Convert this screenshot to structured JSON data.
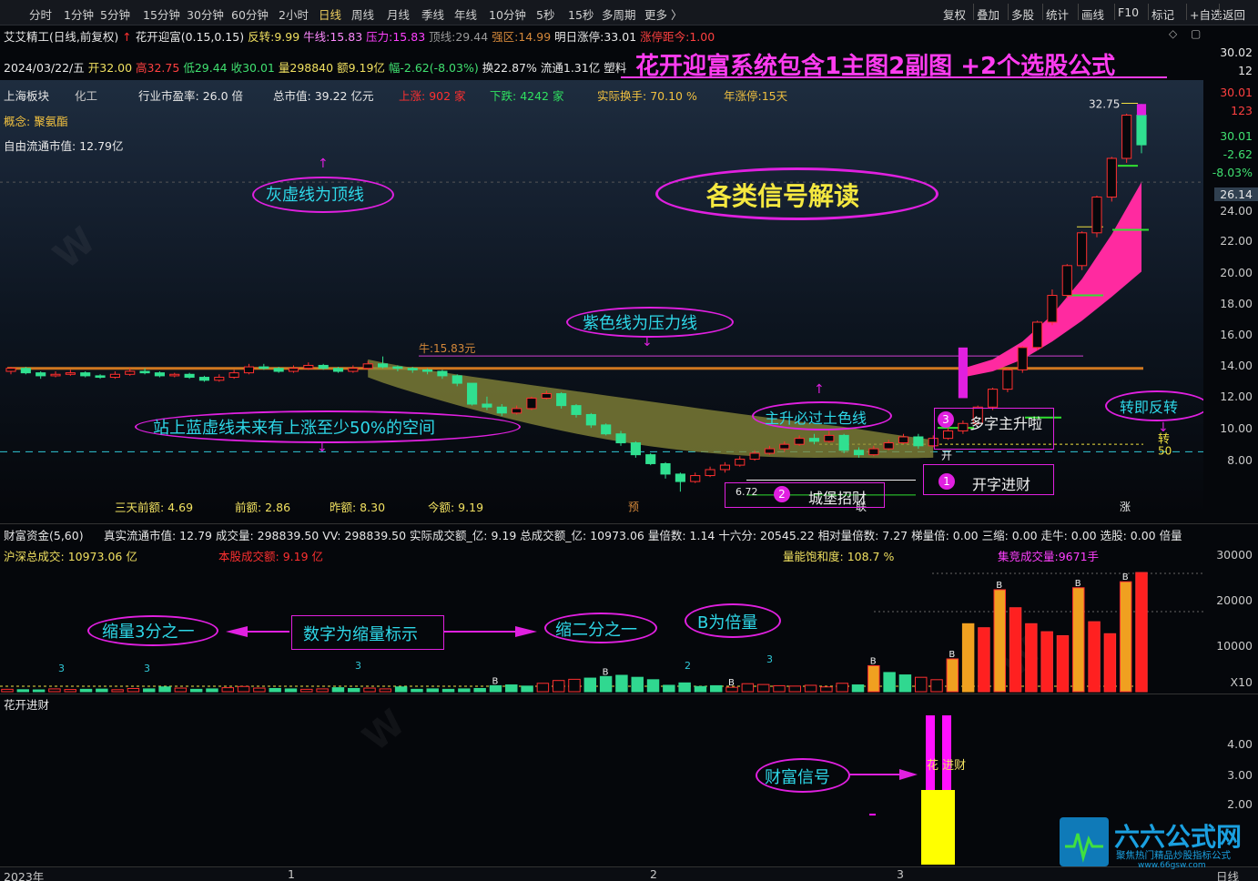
{
  "toolbar": {
    "tabs": [
      "分时",
      "1分钟",
      "5分钟",
      "15分钟",
      "30分钟",
      "60分钟",
      "2小时",
      "日线",
      "周线",
      "月线",
      "季线",
      "年线",
      "10分钟",
      "5秒",
      "15秒",
      "多周期",
      "更多 〉"
    ],
    "active_tab": "日线",
    "right_buttons": [
      "复权",
      "叠加",
      "多股",
      "统计",
      "画线",
      "F10",
      "标记",
      "+自选",
      "返回"
    ]
  },
  "header": {
    "stock_name": "艾艾精工",
    "mode": "(日线,前复权)",
    "indicator": "花开迎富(0.15,0.15)",
    "fanzhuan_label": "反转:",
    "fanzhuan": "9.99",
    "niuxian_label": "牛线:",
    "niuxian": "15.83",
    "yali_label": "压力:",
    "yali": "15.83",
    "dingxian_label": "顶线:",
    "dingxian": "29.44",
    "qiangqu_label": "强区:",
    "qiangqu": "14.99",
    "mingri_label": "明日涨停:",
    "mingri": "33.01",
    "juli_label": "涨停距今:",
    "juli": "1.00",
    "date": "2024/03/22/五",
    "open": "开32.00",
    "high": "高32.75",
    "low": "低29.44",
    "close": "收30.01",
    "vol": "量298840",
    "amt": "额9.19亿",
    "chg": "幅-2.62(-8.03%)",
    "turn": "换22.87%",
    "float": "流通1.31亿",
    "industry_tag": "塑料",
    "promo": "花开迎富系统包含1主图2副图 +2个选股公式"
  },
  "info": {
    "board": "上海板块",
    "sector": "化工",
    "pe_label": "行业市盈率:",
    "pe": "26.0 倍",
    "mcap_label": "总市值:",
    "mcap": "39.22 亿元",
    "up_label": "上涨:",
    "up": "902 家",
    "down_label": "下跌:",
    "down": "4242 家",
    "turn_label": "实际换手:",
    "turn": "70.10 %",
    "limit_label": "年涨停:",
    "limit": "15天",
    "concept_label": "概念:",
    "concept": "聚氨酯",
    "freecap_label": "自由流通市值:",
    "freecap": "12.79亿"
  },
  "annotations": {
    "grey_line": "灰虚线为顶线",
    "signals": "各类信号解读",
    "purple_line": "紫色线为压力线",
    "earth_line": "主升必过土色线",
    "blue_line": "站上蓝虚线未来有上涨至少50%的空间",
    "reversal": "转即反转",
    "sig1": "开字进财",
    "sig2": "城堡招财",
    "sig3": "多字主升啦",
    "shrink3": "缩量3分之一",
    "digit": "数字为缩量标示",
    "shrink2": "缩二分之一",
    "bmult": "B为倍量",
    "wealth": "财富信号"
  },
  "chart_labels": {
    "niu": "牛:15.83元",
    "low_price": "6.72",
    "high_price": "32.75",
    "kai": "开",
    "zhuan": "转",
    "fifty": "50",
    "yu": "预",
    "lian": "联",
    "zhang": "涨",
    "bot1": "三天前额: 4.69",
    "bot2": "前额: 2.86",
    "bot3": "昨额: 8.30",
    "bot4": "今额: 9.19",
    "flower": "花 进财"
  },
  "price_axis": {
    "labels": [
      "30.02",
      "12",
      "30.01",
      "123",
      "30.01",
      "-2.62",
      "-8.03%",
      "26.14",
      "24.00",
      "22.00",
      "20.00",
      "18.00",
      "16.00",
      "14.00",
      "12.00",
      "10.00",
      "8.00"
    ]
  },
  "sub1": {
    "title": "财富资金(5,60)",
    "line": "真实流通市值: 12.79  成交量: 298839.50  VV: 298839.50  实际成交额_亿: 9.19  总成交额_亿: 10973.06  量倍数: 1.14  十六分: 20545.22  相对量倍数: 7.27  梯量倍: 0.00  三缩: 0.00  走牛: 0.00  选股: 0.00  倍量",
    "hs_label": "沪深总成交:",
    "hs": "10973.06 亿",
    "self_label": "本股成交额:",
    "self": "9.19 亿",
    "sat_label": "量能饱和度:",
    "sat": "108.7 %",
    "bid_label": "集竞成交量:",
    "bid": "9671手",
    "axis": [
      "30000",
      "20000",
      "10000",
      "X10"
    ]
  },
  "sub2": {
    "title": "花开进财",
    "axis": [
      "4.00",
      "3.00",
      "2.00"
    ]
  },
  "xaxis": {
    "labels": [
      "2023年",
      "1",
      "2",
      "3"
    ],
    "right": "日线"
  },
  "logo": {
    "text": "六六公式网",
    "sub": "聚焦热门精品炒股指标公式",
    "url": "www.66gsw.com"
  },
  "chart_data": {
    "type": "candlestick",
    "ylim": [
      6.0,
      33.5
    ],
    "candles": [
      [
        14.8,
        15.0,
        15.1,
        14.6
      ],
      [
        15.0,
        14.7,
        15.1,
        14.6
      ],
      [
        14.7,
        14.5,
        14.8,
        14.3
      ],
      [
        14.5,
        14.6,
        14.8,
        14.4
      ],
      [
        14.6,
        14.7,
        14.9,
        14.5
      ],
      [
        14.7,
        14.5,
        14.8,
        14.4
      ],
      [
        14.5,
        14.4,
        14.6,
        14.3
      ],
      [
        14.4,
        14.6,
        14.8,
        14.3
      ],
      [
        14.6,
        14.8,
        15.0,
        14.5
      ],
      [
        14.8,
        14.7,
        15.0,
        14.6
      ],
      [
        14.7,
        14.5,
        14.8,
        14.4
      ],
      [
        14.5,
        14.6,
        14.7,
        14.4
      ],
      [
        14.6,
        14.4,
        14.7,
        14.3
      ],
      [
        14.4,
        14.2,
        14.5,
        14.1
      ],
      [
        14.2,
        14.4,
        14.6,
        14.1
      ],
      [
        14.4,
        14.7,
        14.9,
        14.3
      ],
      [
        14.7,
        15.1,
        15.3,
        14.6
      ],
      [
        15.1,
        15.0,
        15.3,
        14.9
      ],
      [
        15.0,
        14.8,
        15.1,
        14.7
      ],
      [
        14.8,
        15.0,
        15.2,
        14.7
      ],
      [
        15.0,
        15.2,
        15.4,
        14.9
      ],
      [
        15.2,
        15.0,
        15.3,
        14.9
      ],
      [
        15.0,
        14.8,
        15.1,
        14.7
      ],
      [
        14.8,
        15.0,
        15.2,
        14.7
      ],
      [
        15.0,
        15.3,
        15.5,
        14.9
      ],
      [
        15.3,
        15.1,
        15.8,
        15.0
      ],
      [
        15.1,
        15.0,
        15.2,
        14.8
      ],
      [
        15.0,
        14.9,
        15.1,
        14.7
      ],
      [
        14.9,
        14.8,
        15.0,
        14.6
      ],
      [
        14.8,
        14.5,
        14.9,
        14.3
      ],
      [
        14.5,
        14.0,
        14.6,
        13.8
      ],
      [
        14.0,
        12.6,
        14.0,
        12.5
      ],
      [
        12.6,
        12.4,
        13.1,
        12.2
      ],
      [
        12.4,
        12.0,
        12.6,
        11.8
      ],
      [
        12.0,
        12.3,
        12.5,
        11.9
      ],
      [
        12.3,
        13.0,
        13.1,
        12.2
      ],
      [
        13.0,
        13.3,
        13.5,
        12.9
      ],
      [
        13.3,
        12.5,
        13.4,
        12.3
      ],
      [
        12.5,
        11.9,
        12.6,
        11.7
      ],
      [
        11.9,
        11.2,
        12.0,
        11.0
      ],
      [
        11.2,
        10.6,
        11.3,
        10.5
      ],
      [
        10.6,
        10.0,
        10.8,
        9.8
      ],
      [
        10.0,
        9.2,
        10.1,
        9.0
      ],
      [
        9.2,
        8.6,
        9.3,
        8.5
      ],
      [
        8.6,
        7.9,
        8.7,
        7.6
      ],
      [
        7.9,
        7.4,
        8.0,
        6.72
      ],
      [
        7.4,
        7.8,
        8.0,
        7.3
      ],
      [
        7.8,
        8.2,
        8.4,
        7.7
      ],
      [
        8.2,
        8.5,
        8.7,
        8.0
      ],
      [
        8.5,
        8.9,
        9.1,
        8.4
      ],
      [
        8.9,
        9.3,
        9.5,
        8.8
      ],
      [
        9.3,
        9.6,
        9.8,
        9.2
      ],
      [
        9.6,
        9.9,
        10.1,
        9.4
      ],
      [
        9.9,
        10.3,
        10.5,
        9.8
      ],
      [
        10.3,
        10.1,
        10.6,
        9.9
      ],
      [
        10.1,
        10.5,
        10.8,
        10.0
      ],
      [
        10.5,
        9.5,
        10.6,
        9.3
      ],
      [
        9.5,
        9.2,
        9.7,
        9.0
      ],
      [
        9.2,
        9.6,
        9.8,
        9.1
      ],
      [
        9.6,
        10.0,
        10.2,
        9.5
      ],
      [
        10.0,
        10.4,
        10.6,
        9.9
      ],
      [
        10.4,
        9.8,
        10.6,
        9.6
      ],
      [
        9.8,
        10.3,
        10.5,
        9.7
      ],
      [
        10.3,
        10.8,
        11.0,
        10.2
      ],
      [
        10.8,
        11.3,
        11.5,
        10.6
      ],
      [
        11.3,
        12.4,
        12.5,
        11.2
      ],
      [
        12.4,
        13.6,
        13.7,
        12.2
      ],
      [
        13.6,
        14.9,
        15.0,
        13.4
      ],
      [
        14.9,
        16.4,
        16.5,
        14.7
      ],
      [
        16.4,
        18.1,
        18.2,
        16.2
      ],
      [
        18.1,
        19.9,
        20.3,
        17.9
      ],
      [
        19.9,
        21.9,
        22.0,
        19.7
      ],
      [
        21.9,
        24.1,
        24.2,
        21.6
      ],
      [
        24.1,
        26.5,
        26.6,
        23.8
      ],
      [
        26.5,
        29.1,
        29.2,
        26.2
      ],
      [
        29.1,
        32.0,
        32.1,
        28.8
      ],
      [
        32.0,
        30.01,
        32.75,
        29.44
      ]
    ],
    "volume": [
      600,
      500,
      450,
      700,
      550,
      600,
      650,
      500,
      800,
      700,
      1200,
      900,
      600,
      700,
      1000,
      1300,
      900,
      800,
      700,
      600,
      700,
      1000,
      800,
      900,
      700,
      1200,
      600,
      700,
      600,
      700,
      800,
      1500,
      1700,
      1400,
      2100,
      2800,
      3100,
      3400,
      3800,
      4100,
      3600,
      3000,
      1600,
      2200,
      1300,
      1500,
      1100,
      2000,
      1800,
      1500,
      1400,
      1600,
      1200,
      2100,
      1700,
      6500,
      4800,
      4200,
      3600,
      3000,
      8200,
      17000,
      16000,
      25500,
      21000,
      17000,
      15000,
      14000,
      26000,
      17500,
      14500,
      27500,
      29800
    ]
  }
}
